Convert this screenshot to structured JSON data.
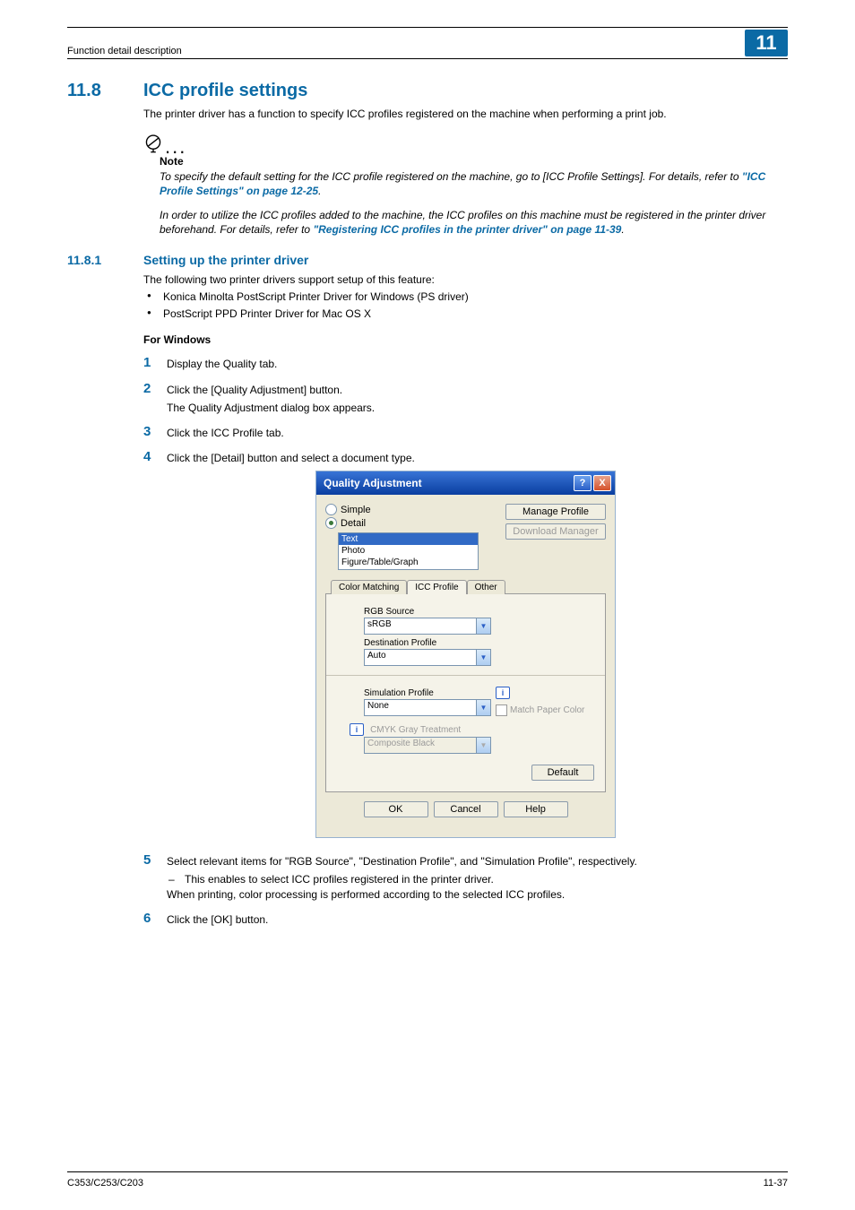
{
  "header": {
    "running_head": "Function detail description",
    "chapter_badge": "11"
  },
  "section_11_8": {
    "number": "11.8",
    "title": "ICC profile settings",
    "intro": "The printer driver has a function to specify ICC profiles registered on the machine when performing a print job."
  },
  "note": {
    "label": "Note",
    "p1_a": "To specify the default setting for the ICC profile registered on the machine, go to [ICC Profile Settings]. For details, refer to ",
    "p1_link": "\"ICC Profile Settings\" on page 12-25",
    "p1_b": ".",
    "p2_a": "In order to utilize the ICC profiles added to the machine, the ICC profiles on this machine must be registered in the printer driver beforehand. For details, refer to ",
    "p2_link": "\"Registering ICC profiles in the printer driver\" on page 11-39",
    "p2_b": "."
  },
  "section_11_8_1": {
    "number": "11.8.1",
    "title": "Setting up the printer driver",
    "intro": "The following two printer drivers support setup of this feature:",
    "bullets": [
      "Konica Minolta PostScript Printer Driver for Windows (PS driver)",
      "PostScript PPD Printer Driver for Mac OS X"
    ]
  },
  "windows_block": {
    "heading": "For Windows",
    "steps": {
      "1": "Display the Quality tab.",
      "2": {
        "text": "Click the [Quality Adjustment] button.",
        "sub": "The Quality Adjustment dialog box appears."
      },
      "3": "Click the ICC Profile tab.",
      "4": "Click the [Detail] button and select a document type.",
      "5": {
        "text": "Select relevant items for \"RGB Source\", \"Destination Profile\", and \"Simulation Profile\", respectively.",
        "dash": "This enables to select ICC profiles registered in the printer driver.",
        "after": "When printing, color processing is performed according to the selected ICC profiles."
      },
      "6": "Click the [OK] button."
    }
  },
  "dialog": {
    "title": "Quality Adjustment",
    "title_icons": {
      "help": "?",
      "close": "X"
    },
    "radio_simple": "Simple",
    "radio_detail": "Detail",
    "right_buttons": {
      "manage": "Manage Profile",
      "download": "Download Manager"
    },
    "listbox": {
      "items": [
        "Text",
        "Photo",
        "Figure/Table/Graph"
      ],
      "selected_index": 0
    },
    "tabs": {
      "t1": "Color Matching",
      "t2": "ICC Profile",
      "t3": "Other",
      "active_index": 1
    },
    "panel": {
      "rgb_source_lbl": "RGB Source",
      "rgb_source_val": "sRGB",
      "dest_profile_lbl": "Destination Profile",
      "dest_profile_val": "Auto",
      "sim_profile_lbl": "Simulation Profile",
      "sim_profile_val": "None",
      "match_paper": "Match Paper Color",
      "cmyk_lbl": "CMYK Gray Treatment",
      "cmyk_val": "Composite Black",
      "default_btn": "Default"
    },
    "bottom": {
      "ok": "OK",
      "cancel": "Cancel",
      "help": "Help"
    }
  },
  "footer": {
    "left": "C353/C253/C203",
    "right": "11-37"
  }
}
